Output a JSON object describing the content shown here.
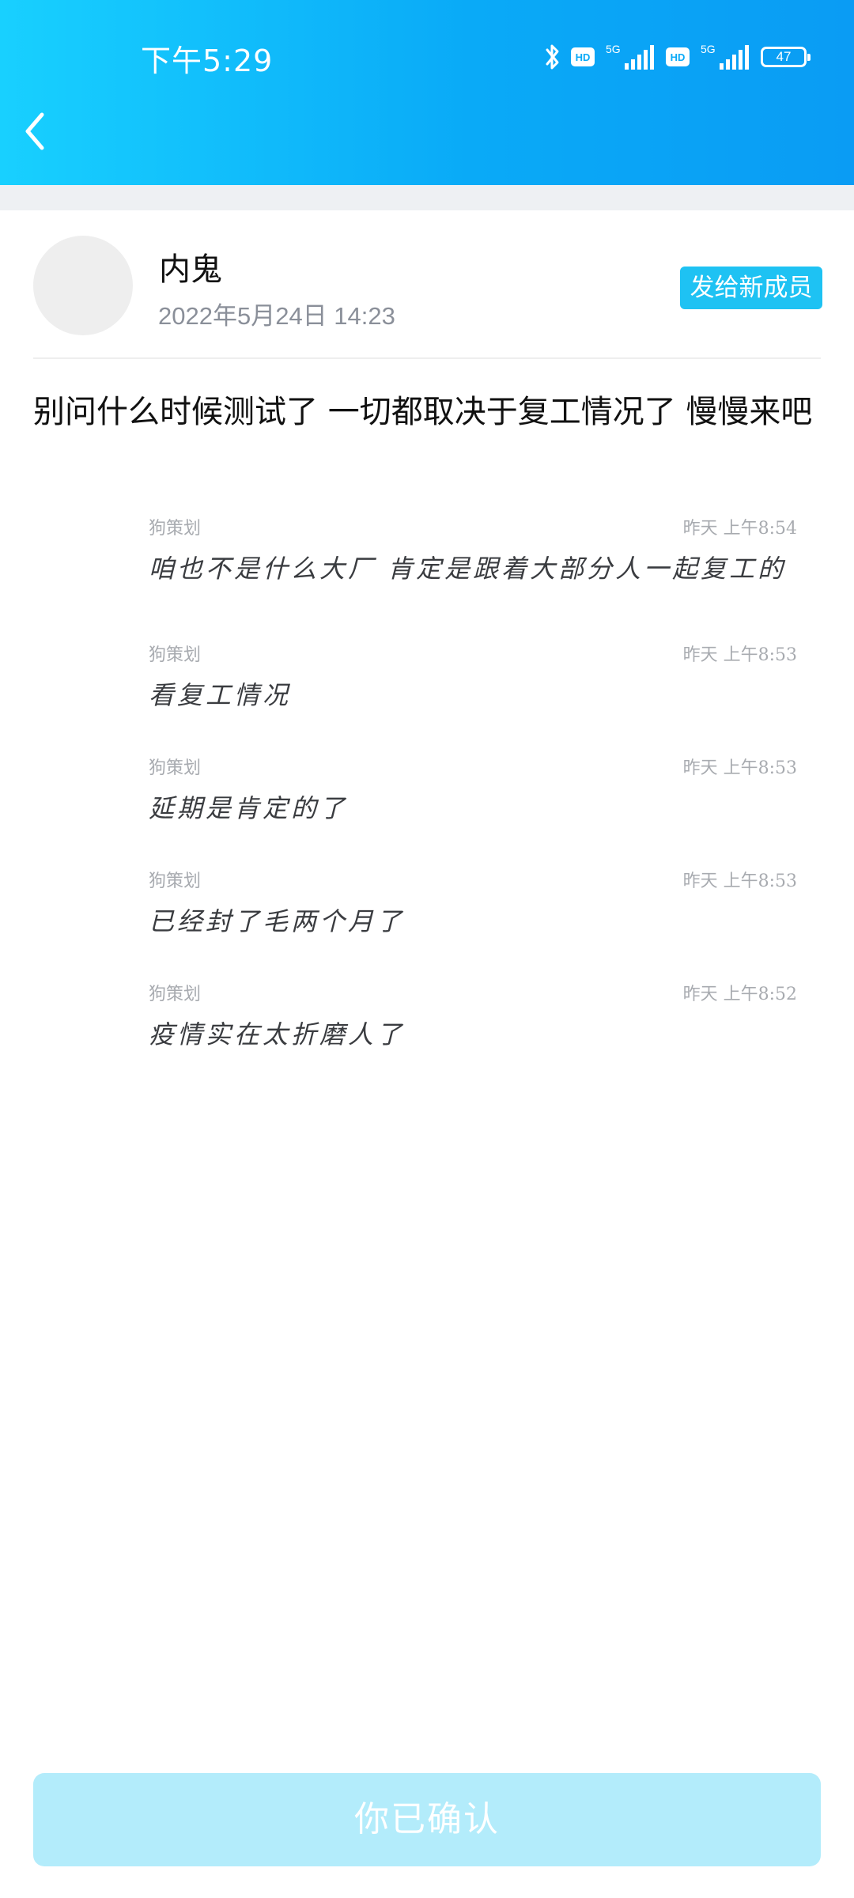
{
  "status_bar": {
    "time": "下午5:29",
    "battery": "47",
    "network_1": "5G",
    "network_2": "5G",
    "hd_1": "HD",
    "hd_2": "HD"
  },
  "colors": {
    "header_gradient_start": "#18d0ff",
    "header_gradient_end": "#0a9cf4",
    "accent": "#1ec2f3",
    "confirm_disabled": "#b3ecfb"
  },
  "post": {
    "author": "内鬼",
    "date": "2022年5月24日 14:23",
    "send_button": "发给新成员",
    "body": "别问什么时候测试了 一切都取决于复工情况了 慢慢来吧"
  },
  "chat_messages": [
    {
      "sender": "狗策划",
      "time": "昨天 上午8:54",
      "text": "咱也不是什么大厂  肯定是跟着大部分人一起复工的"
    },
    {
      "sender": "狗策划",
      "time": "昨天 上午8:53",
      "text": "看复工情况"
    },
    {
      "sender": "狗策划",
      "time": "昨天 上午8:53",
      "text": "延期是肯定的了"
    },
    {
      "sender": "狗策划",
      "time": "昨天 上午8:53",
      "text": "已经封了毛两个月了"
    },
    {
      "sender": "狗策划",
      "time": "昨天 上午8:52",
      "text": "疫情实在太折磨人了"
    }
  ],
  "confirm_button": "你已确认",
  "icons": {
    "back": "chevron-left-icon",
    "bluetooth": "bluetooth-icon",
    "signal": "signal-icon",
    "battery": "battery-icon"
  }
}
